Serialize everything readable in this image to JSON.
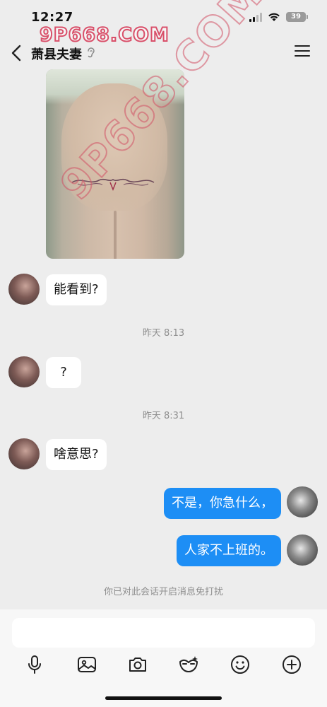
{
  "status_bar": {
    "time": "12:27",
    "battery": "39"
  },
  "watermark": {
    "top": "9P668.COM",
    "diagonal": "9P668.COM"
  },
  "header": {
    "title": "萧县夫妻",
    "back_icon": "chevron-left-icon",
    "ear_icon": "ear-icon",
    "menu_icon": "hamburger-menu-icon"
  },
  "messages": [
    {
      "side": "left",
      "text": "能看到?"
    },
    {
      "type": "time",
      "text": "昨天 8:13"
    },
    {
      "side": "left",
      "text": "?"
    },
    {
      "type": "time",
      "text": "昨天 8:31"
    },
    {
      "side": "left",
      "text": "啥意思?"
    },
    {
      "side": "right",
      "text": "不是，你急什么，"
    },
    {
      "side": "right",
      "text": "人家不上班的。"
    }
  ],
  "notice": "你已对此会话开启消息免打扰",
  "input": {
    "placeholder": ""
  },
  "toolbar": [
    "microphone-icon",
    "image-icon",
    "camera-icon",
    "mask-icon",
    "emoji-icon",
    "plus-circle-icon"
  ]
}
